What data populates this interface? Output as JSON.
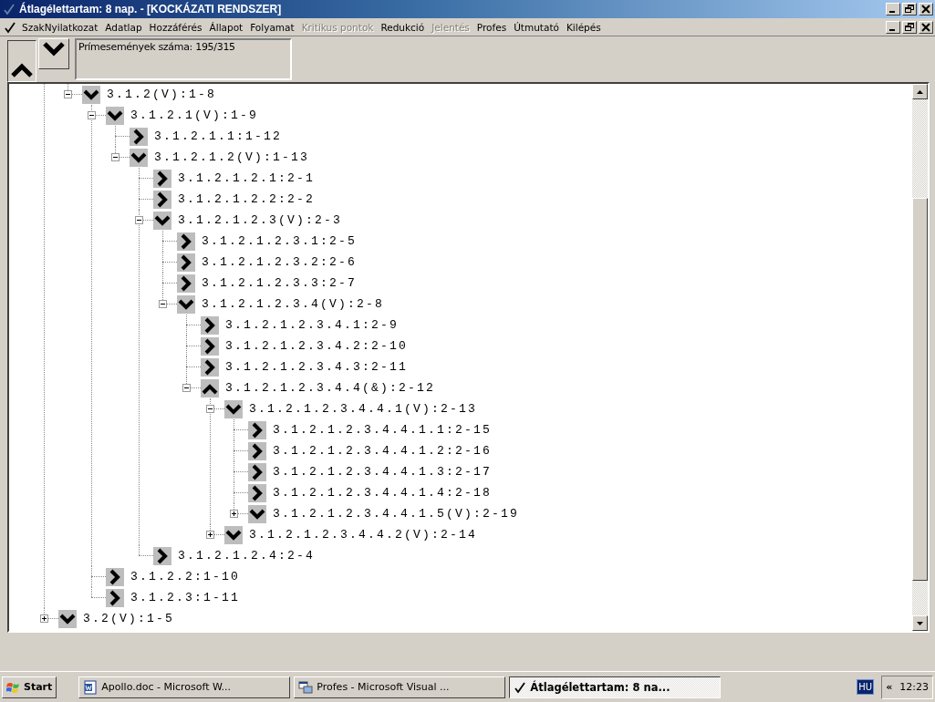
{
  "window": {
    "title": "Átlagélettartam: 8 nap. - [KOCKÁZATI RENDSZER]"
  },
  "menu": [
    {
      "label": "SzakNyilatkozat",
      "disabled": false
    },
    {
      "label": "Adatlap",
      "disabled": false
    },
    {
      "label": "Hozzáférés",
      "disabled": false
    },
    {
      "label": "Állapot",
      "disabled": false
    },
    {
      "label": "Folyamat",
      "disabled": false
    },
    {
      "label": "Kritikus pontok",
      "disabled": true
    },
    {
      "label": "Redukció",
      "disabled": false
    },
    {
      "label": "Jelentés",
      "disabled": true
    },
    {
      "label": "Profes",
      "disabled": false
    },
    {
      "label": "Útmutató",
      "disabled": false
    },
    {
      "label": "Kilépés",
      "disabled": false
    }
  ],
  "toolbar": {
    "counter": "Prímesemények száma: 195/315"
  },
  "tree": {
    "nodes": [
      {
        "label": "3.1.2(V):1-8",
        "kind": "or",
        "expanded": true,
        "children": [
          {
            "label": "3.1.2.1(V):1-9",
            "kind": "or",
            "expanded": true,
            "children": [
              {
                "label": "3.1.2.1.1:1-12",
                "kind": "leaf"
              },
              {
                "label": "3.1.2.1.2(V):1-13",
                "kind": "or",
                "expanded": true,
                "children": [
                  {
                    "label": "3.1.2.1.2.1:2-1",
                    "kind": "leaf"
                  },
                  {
                    "label": "3.1.2.1.2.2:2-2",
                    "kind": "leaf"
                  },
                  {
                    "label": "3.1.2.1.2.3(V):2-3",
                    "kind": "or",
                    "expanded": true,
                    "children": [
                      {
                        "label": "3.1.2.1.2.3.1:2-5",
                        "kind": "leaf"
                      },
                      {
                        "label": "3.1.2.1.2.3.2:2-6",
                        "kind": "leaf"
                      },
                      {
                        "label": "3.1.2.1.2.3.3:2-7",
                        "kind": "leaf"
                      },
                      {
                        "label": "3.1.2.1.2.3.4(V):2-8",
                        "kind": "or",
                        "expanded": true,
                        "children": [
                          {
                            "label": "3.1.2.1.2.3.4.1:2-9",
                            "kind": "leaf"
                          },
                          {
                            "label": "3.1.2.1.2.3.4.2:2-10",
                            "kind": "leaf"
                          },
                          {
                            "label": "3.1.2.1.2.3.4.3:2-11",
                            "kind": "leaf"
                          },
                          {
                            "label": "3.1.2.1.2.3.4.4(&):2-12",
                            "kind": "and",
                            "expanded": true,
                            "children": [
                              {
                                "label": "3.1.2.1.2.3.4.4.1(V):2-13",
                                "kind": "or",
                                "expanded": true,
                                "children": [
                                  {
                                    "label": "3.1.2.1.2.3.4.4.1.1:2-15",
                                    "kind": "leaf"
                                  },
                                  {
                                    "label": "3.1.2.1.2.3.4.4.1.2:2-16",
                                    "kind": "leaf"
                                  },
                                  {
                                    "label": "3.1.2.1.2.3.4.4.1.3:2-17",
                                    "kind": "leaf"
                                  },
                                  {
                                    "label": "3.1.2.1.2.3.4.4.1.4:2-18",
                                    "kind": "leaf"
                                  },
                                  {
                                    "label": "3.1.2.1.2.3.4.4.1.5(V):2-19",
                                    "kind": "or",
                                    "expanded": false
                                  }
                                ]
                              },
                              {
                                "label": "3.1.2.1.2.3.4.4.2(V):2-14",
                                "kind": "or",
                                "expanded": false
                              }
                            ]
                          }
                        ]
                      }
                    ]
                  },
                  {
                    "label": "3.1.2.1.2.4:2-4",
                    "kind": "leaf"
                  }
                ]
              }
            ]
          },
          {
            "label": "3.1.2.2:1-10",
            "kind": "leaf"
          },
          {
            "label": "3.1.2.3:1-11",
            "kind": "leaf"
          }
        ]
      },
      {
        "label": "3.2(V):1-5",
        "kind": "or",
        "expanded": false
      }
    ]
  },
  "taskbar": {
    "start": "Start",
    "tasks": [
      {
        "label": "Apollo.doc - Microsoft W...",
        "kind": "document",
        "selected": false
      },
      {
        "label": "Profes - Microsoft Visual ...",
        "kind": "ide",
        "selected": false
      },
      {
        "label": "Átlagélettartam: 8 na...",
        "kind": "check",
        "selected": true
      }
    ],
    "language": "HU",
    "chevron": "«",
    "clock": "12:23"
  }
}
